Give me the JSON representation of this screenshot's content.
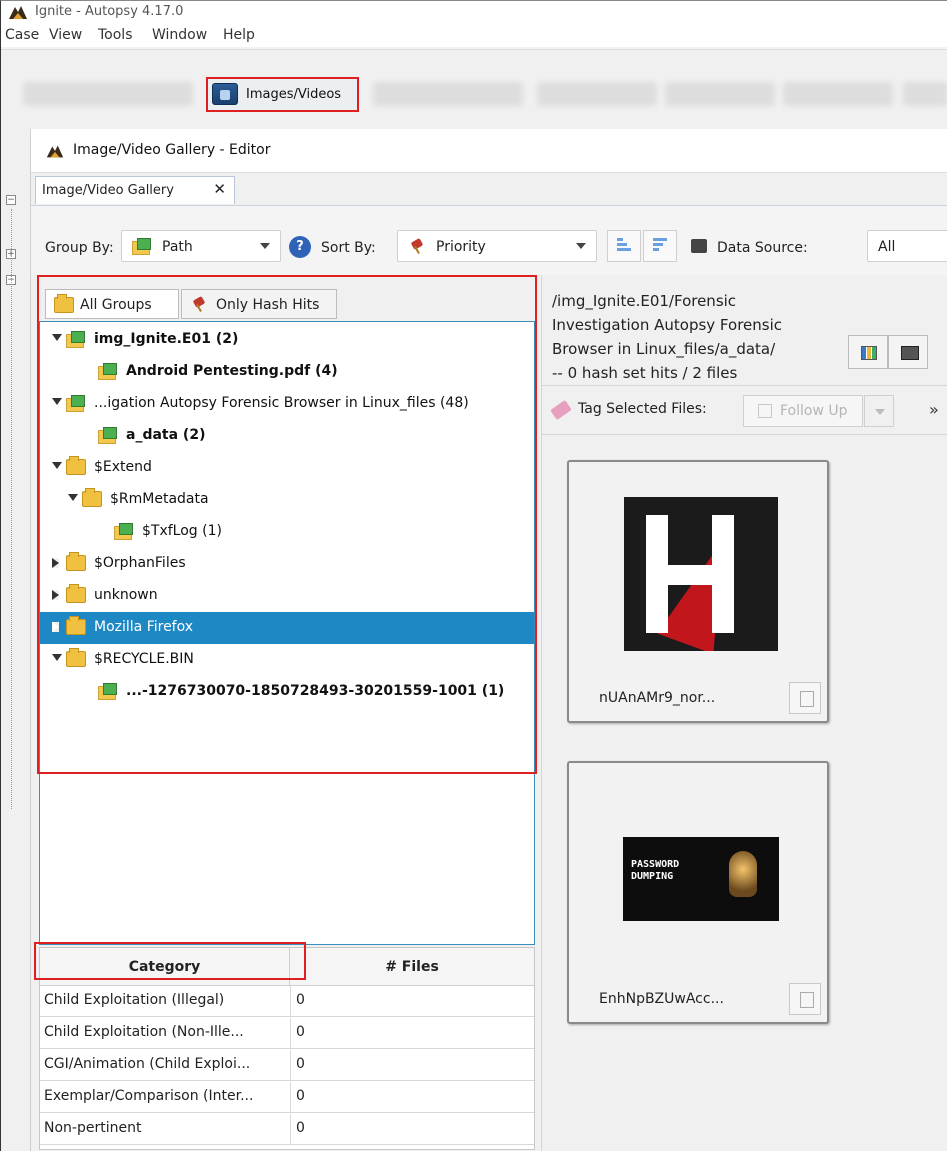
{
  "window": {
    "title": "Ignite - Autopsy 4.17.0"
  },
  "menu": [
    "Case",
    "View",
    "Tools",
    "Window",
    "Help"
  ],
  "toolbar": {
    "images_videos_label": "Images/Videos"
  },
  "editor": {
    "title": "Image/Video Gallery - Editor",
    "tab_label": "Image/Video Gallery",
    "tab_close": "✕"
  },
  "controls": {
    "group_by_label": "Group By:",
    "group_by_value": "Path",
    "sort_by_label": "Sort By:",
    "sort_by_value": "Priority",
    "data_source_label": "Data Source:",
    "data_source_value": "All"
  },
  "group_tabs": {
    "all_groups": "All Groups",
    "only_hash_hits": "Only Hash Hits"
  },
  "tree": [
    {
      "label": "img_Ignite.E01 (2)",
      "bold": true,
      "expand": "down",
      "icon": "image-folder"
    },
    {
      "label": "Android Pentesting.pdf (4)",
      "bold": true,
      "expand": "none",
      "icon": "image-folder"
    },
    {
      "label": "...igation Autopsy Forensic Browser in Linux_files (48)",
      "bold": false,
      "expand": "down",
      "icon": "image-folder"
    },
    {
      "label": "a_data (2)",
      "bold": true,
      "expand": "none",
      "icon": "image-folder"
    },
    {
      "label": "$Extend",
      "bold": false,
      "expand": "down",
      "icon": "folder"
    },
    {
      "label": "$RmMetadata",
      "bold": false,
      "expand": "down",
      "icon": "folder"
    },
    {
      "label": "$TxfLog (1)",
      "bold": false,
      "expand": "none",
      "icon": "image-folder"
    },
    {
      "label": "$OrphanFiles",
      "bold": false,
      "expand": "right",
      "icon": "folder"
    },
    {
      "label": "unknown",
      "bold": false,
      "expand": "right",
      "icon": "folder"
    },
    {
      "label": "Mozilla Firefox",
      "bold": false,
      "expand": "right",
      "icon": "folder",
      "selected": true
    },
    {
      "label": "$RECYCLE.BIN",
      "bold": false,
      "expand": "down",
      "icon": "folder"
    },
    {
      "label": "...-1276730070-1850728493-30201559-1001 (1)",
      "bold": true,
      "expand": "none",
      "icon": "image-folder"
    }
  ],
  "category_table": {
    "headers": [
      "Category",
      "# Files"
    ],
    "rows": [
      {
        "name": "Child Exploitation (Illegal)",
        "count": "0"
      },
      {
        "name": "Child Exploitation (Non-Ille...",
        "count": "0"
      },
      {
        "name": "CGI/Animation (Child Exploi...",
        "count": "0"
      },
      {
        "name": "Exemplar/Comparison (Inter...",
        "count": "0"
      },
      {
        "name": "Non-pertinent",
        "count": "0"
      }
    ]
  },
  "group_info": {
    "lines": [
      "/img_Ignite.E01/Forensic",
      "Investigation Autopsy Forensic",
      "Browser in Linux_files/a_data/",
      "-- 0 hash set hits / 2 files"
    ]
  },
  "tag_bar": {
    "label": "Tag Selected Files:",
    "follow_up": "Follow Up",
    "more": "»"
  },
  "thumbnails": [
    {
      "caption": "nUAnAMr9_nor..."
    },
    {
      "caption": "EnhNpBZUwAcc...",
      "image_text": "PASSWORD\nDUMPING"
    }
  ]
}
